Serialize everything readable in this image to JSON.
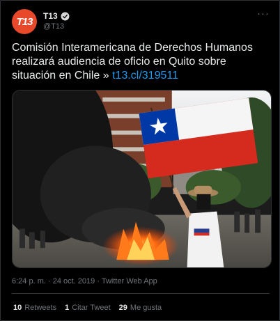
{
  "author": {
    "avatar_text": "T13",
    "display_name": "T13",
    "handle": "@T13",
    "verified": true
  },
  "more_label": "···",
  "tweet": {
    "text": "Comisión Interamericana de Derechos Humanos realizará audiencia de oficio en Quito sobre situación en Chile » ",
    "link": "t13.cl/319511"
  },
  "meta": {
    "time": "6:24 p. m.",
    "separator": "·",
    "date": "24 oct. 2019",
    "source": "Twitter Web App"
  },
  "stats": {
    "retweets_count": "10",
    "retweets_label": "Retweets",
    "quotes_count": "1",
    "quotes_label": "Citar Tweet",
    "likes_count": "29",
    "likes_label": "Me gusta"
  },
  "colors": {
    "background": "#000000",
    "brand": "#e8492a",
    "link": "#1d9bf0",
    "secondary_text": "#71767b",
    "border": "#2f3336"
  }
}
